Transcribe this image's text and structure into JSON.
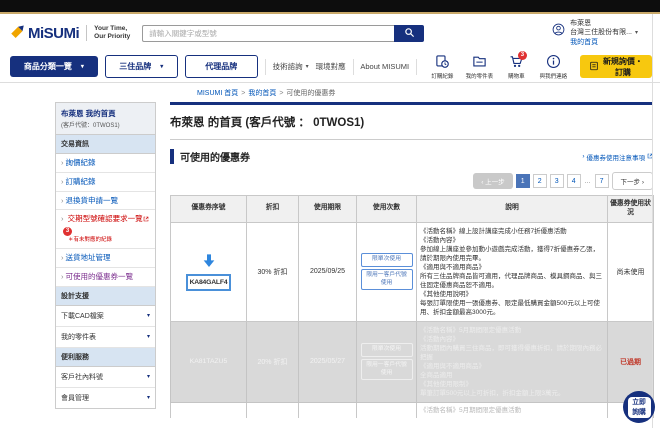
{
  "colors": {
    "brand_navy": "#16307e",
    "accent_yellow": "#f7c80f",
    "link_blue": "#0055b8",
    "visited_purple": "#7b2d8e",
    "alert_red": "#cc0000",
    "expired_red": "#c0392b",
    "active_page_blue": "#4a74b8",
    "download_arrow_blue": "#2e86de"
  },
  "header": {
    "logo_text": "MiSUMi",
    "logo_icon": "misumi-arrow-icon",
    "tagline_line1": "Your Time,",
    "tagline_line2": "Our Priority",
    "search_placeholder": "請輸入關鍵字或型號",
    "search_icon": "search-icon",
    "account": {
      "user_name": "布萊恩",
      "company": "台灣三住股份有限...",
      "my_home_link": "我的首頁"
    }
  },
  "navbar": {
    "category_menu_label": "商品分類一覽",
    "misumi_brand_label": "三住品牌",
    "agent_brand_label": "代理品牌",
    "tech_consult_label": "技術諮詢",
    "environment_label": "環境對應",
    "about_label": "About MISUMI",
    "quick_links": [
      {
        "label": "訂購紀錄",
        "icon": "order-history-icon"
      },
      {
        "label": "我的零件表",
        "icon": "parts-list-icon"
      },
      {
        "label": "購物車",
        "icon": "cart-icon",
        "badge": "3"
      },
      {
        "label": "與我們連絡",
        "icon": "contact-icon"
      }
    ],
    "new_quote_label": "新規詢價・訂購",
    "new_quote_icon": "document-icon"
  },
  "breadcrumb": {
    "home": "MISUMI 首頁",
    "my_page": "我的首頁",
    "current": "可使用的優惠券",
    "separator": ">"
  },
  "sidebar": {
    "user_title": "布萊恩 我的首頁",
    "user_code": "(客戶代號：0TWOS1)",
    "section_trade": "交易資訊",
    "quote_history": "詢價紀錄",
    "order_history": "訂購紀錄",
    "return_request": "退換貨申請一覽",
    "delivery_confirm": "交期型號確認要求一覽",
    "delivery_confirm_badge": "3",
    "delivery_confirm_note": "＊有未對應的紀錄",
    "address_mgmt": "送貨地址管理",
    "coupon_list": "可使用的優惠券一覽",
    "section_design": "設計支援",
    "cad_download": "下載CAD檔案",
    "my_parts_list": "我的零件表",
    "section_service": "便利服務",
    "customer_part_no": "客戶社內料號",
    "member_mgmt": "會員管理"
  },
  "main": {
    "page_title": "布萊恩 的首頁 (客戶代號 ： 0TWOS1)",
    "section_title": "可使用的優惠券",
    "notice_link": "優惠券使用注意事項",
    "pagination": {
      "prev_label": "上一步",
      "next_label": "下一步",
      "pages": [
        "1",
        "2",
        "3",
        "4",
        "7"
      ],
      "ellipsis": "...",
      "active_page": "1"
    },
    "table": {
      "headers": [
        "優惠券序號",
        "折扣",
        "使用期限",
        "使用次數",
        "說明",
        "優惠券使用狀況"
      ],
      "rows": [
        {
          "code": "KA84GALF4",
          "discount": "30% 折扣",
          "expiry": "2025/09/25",
          "badges": [
            "限單次使用",
            "限用一客戶代號使用"
          ],
          "desc": [
            "《活動名稱》線上設計講座完成小任務7折優惠活動",
            "《活動內容》",
            "參加線上講座並參加動小遊戲完成活動，獲得7折優惠券乙張，請於期限內使用完畢。",
            "《適用與不適用商品》",
            "所有三住品牌商品皆可適用，代理品牌商品、模具鋼商品、與三住固定優惠商品恕不適用。",
            "《其他使用說明》",
            "每張訂單限使用一張優惠券、限定最低購買金額500元以上可使用、折扣金額最高3000元。"
          ],
          "status": "尚未使用",
          "state": "active"
        },
        {
          "code": "KA81TAZU5",
          "discount": "20% 折扣",
          "expiry": "2025/05/27",
          "badges": [
            "限單次使用",
            "限用一客戶代號使用"
          ],
          "desc": [
            "《活動名稱》5月期間限定優惠活動",
            "《活動內容》",
            "活動期間內購買三住商品，即可獲得優惠折扣，請於期限內務必把握",
            "《適用與不適用商品》",
            "全商品適用",
            "《其他使用限制》",
            "單筆訂單500元以上可折扣，折扣金額上限3萬元。"
          ],
          "status": "已過期",
          "state": "expired"
        }
      ],
      "partial_next_row_first_line": "《活動名稱》5月期間限定優惠活動"
    }
  },
  "floating_button": {
    "line1": "立即",
    "line2": "詢購"
  }
}
